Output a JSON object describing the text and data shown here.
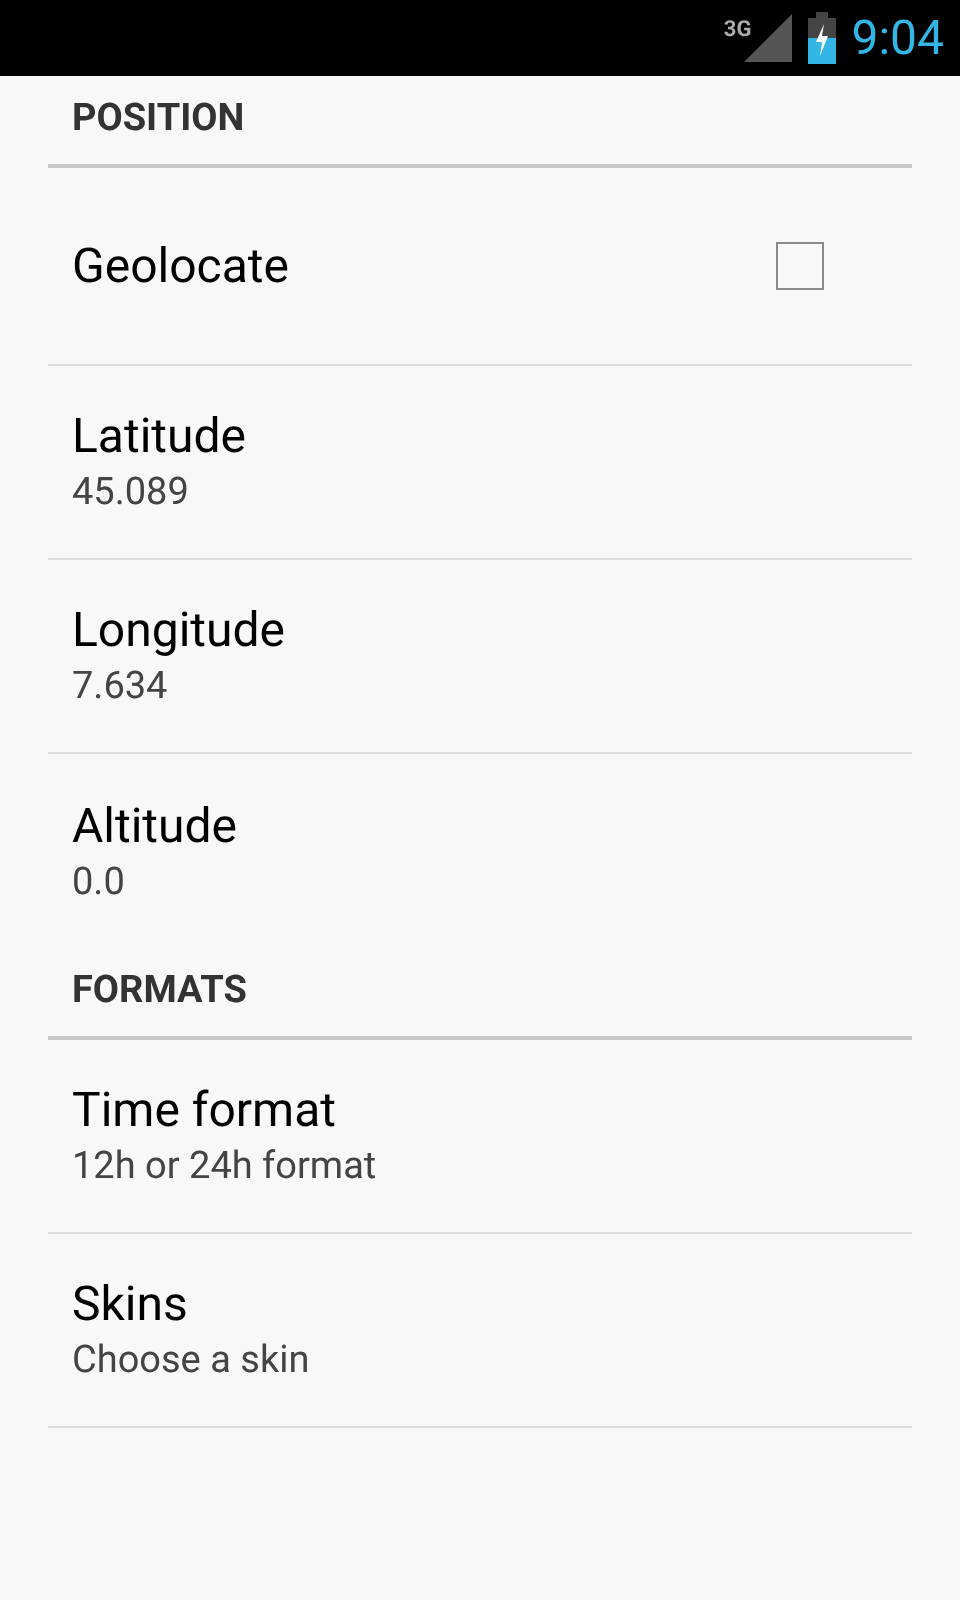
{
  "status_bar": {
    "network": "3G",
    "time": "9:04"
  },
  "sections": [
    {
      "title": "POSITION",
      "items": [
        {
          "kind": "checkbox",
          "title": "Geolocate",
          "checked": false
        },
        {
          "kind": "text",
          "title": "Latitude",
          "summary": "45.089"
        },
        {
          "kind": "text",
          "title": "Longitude",
          "summary": "7.634"
        },
        {
          "kind": "text",
          "title": "Altitude",
          "summary": "0.0"
        }
      ]
    },
    {
      "title": "FORMATS",
      "items": [
        {
          "kind": "text",
          "title": "Time format",
          "summary": "12h or 24h format"
        },
        {
          "kind": "text",
          "title": "Skins",
          "summary": "Choose a skin"
        }
      ]
    }
  ]
}
